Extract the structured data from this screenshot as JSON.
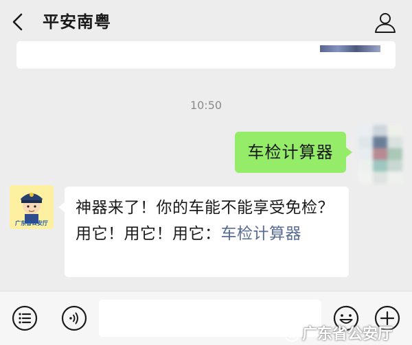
{
  "header": {
    "title": "平安南粤",
    "back_icon": "chevron-left-icon",
    "profile_icon": "person-outline-icon"
  },
  "chat": {
    "timestamp": "10:50",
    "outgoing": {
      "text": "车检计算器",
      "bubble_color": "#95ec69"
    },
    "incoming": {
      "text_before": "神器来了！你的车能不能享受免检？用它！用它！用它：",
      "link_text": "车检计算器",
      "link_color": "#576b95",
      "avatar_caption": "广东省公安厅"
    }
  },
  "input_bar": {
    "menu_icon": "menu-list-icon",
    "voice_icon": "voice-icon",
    "emoji_icon": "emoji-icon",
    "add_icon": "plus-circle-icon",
    "text_value": ""
  },
  "watermark": {
    "text": "广东省公安厅"
  }
}
